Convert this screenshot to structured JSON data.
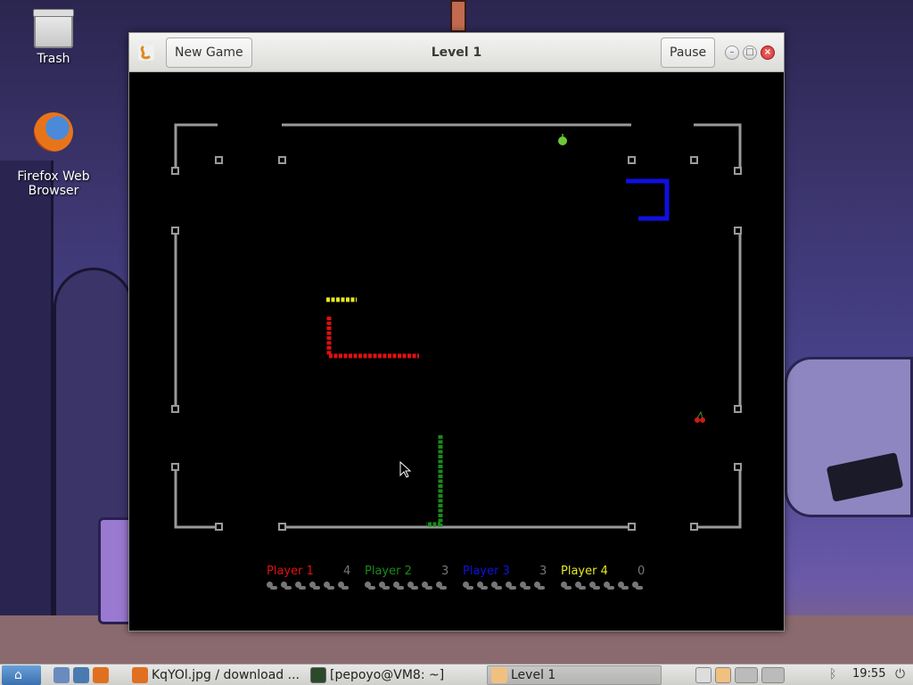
{
  "desktop": {
    "icons": [
      {
        "label": "Trash",
        "icon": "trash-icon"
      },
      {
        "label": "Firefox Web\nBrowser",
        "icon": "firefox-icon"
      }
    ]
  },
  "window": {
    "title": "Level 1",
    "new_game_label": "New Game",
    "pause_label": "Pause",
    "app_icon": "snake-app-icon"
  },
  "game": {
    "colors": {
      "wall": "#9a9a9a",
      "player1": "#e01010",
      "player2": "#1a8a1a",
      "player3": "#1010e0",
      "player4": "#e8e820",
      "apple": "#6cc83a",
      "cherry": "#d01818"
    },
    "items": [
      "apple",
      "cherry"
    ]
  },
  "scoreboard": {
    "players": [
      {
        "name": "Player 1",
        "score": "4",
        "color": "#e01010",
        "lives": 6
      },
      {
        "name": "Player 2",
        "score": "3",
        "color": "#1a8a1a",
        "lives": 6
      },
      {
        "name": "Player 3",
        "score": "3",
        "color": "#1010e0",
        "lives": 6
      },
      {
        "name": "Player 4",
        "score": "0",
        "color": "#e8e820",
        "lives": 6
      }
    ]
  },
  "taskbar": {
    "items": [
      {
        "label": "KqYOl.jpg / download ...",
        "icon": "firefox-icon"
      },
      {
        "label": "[pepoyo@VM8: ~]",
        "icon": "terminal-icon"
      },
      {
        "label": "Level 1",
        "icon": "snake-app-icon",
        "active": true
      }
    ],
    "clock": "19:55"
  }
}
